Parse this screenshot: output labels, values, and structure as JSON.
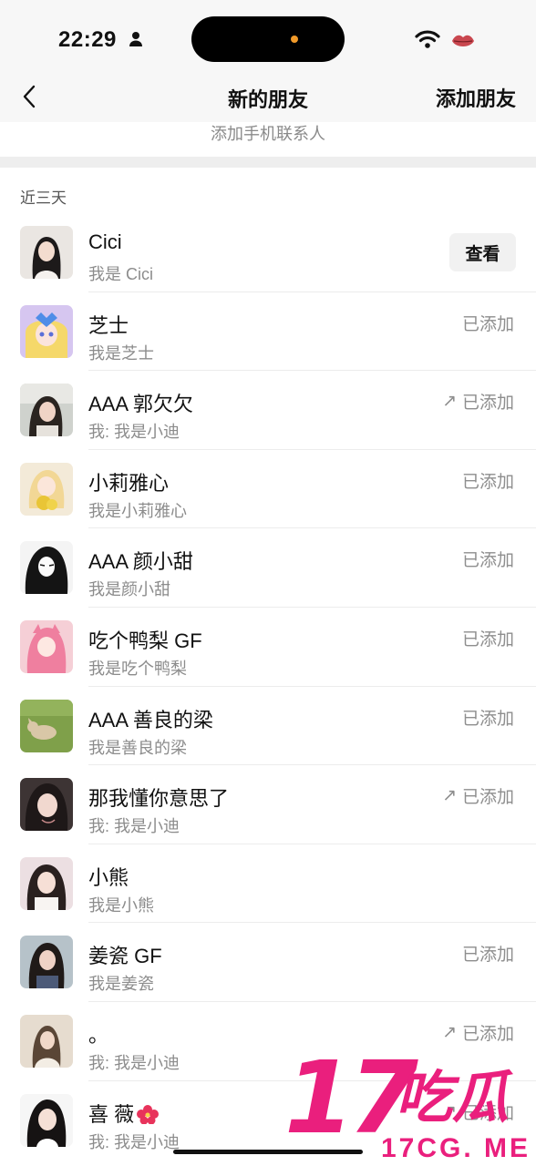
{
  "status_bar": {
    "time": "22:29"
  },
  "nav": {
    "title": "新的朋友",
    "add_friend": "添加朋友"
  },
  "phone_contacts": {
    "label": "添加手机联系人"
  },
  "section": {
    "label": "近三天"
  },
  "colors": {
    "watermark": "#ea1f7d",
    "secondary_text": "#8c8c8c",
    "nav_background": "#f7f7f7"
  },
  "friends": [
    {
      "name": "Cici",
      "message": "我是 Cici",
      "action": "查看"
    },
    {
      "name": "芝士",
      "message": "我是芝士",
      "status": "已添加"
    },
    {
      "name": "AAA 郭欠欠",
      "message": "我: 我是小迪",
      "status": "已添加",
      "arrow": "↗"
    },
    {
      "name": "小莉雅心",
      "message": "我是小莉雅心",
      "status": "已添加"
    },
    {
      "name": "AAA 颜小甜",
      "message": "我是颜小甜",
      "status": "已添加"
    },
    {
      "name": "吃个鸭梨 GF",
      "message": "我是吃个鸭梨",
      "status": "已添加"
    },
    {
      "name": "AAA 善良的梁",
      "message": "我是善良的梁",
      "status": "已添加"
    },
    {
      "name": "那我懂你意思了",
      "message": "我: 我是小迪",
      "status": "已添加",
      "arrow": "↗"
    },
    {
      "name": "小熊",
      "message": "我是小熊"
    },
    {
      "name": "姜瓷 GF",
      "message": "我是姜瓷",
      "status": "已添加"
    },
    {
      "name": "。",
      "message": "我: 我是小迪",
      "status": "已添加",
      "arrow": "↗"
    },
    {
      "name": "喜 薇",
      "message": "我: 我是小迪",
      "status": "已添加",
      "arrow": "↗"
    }
  ],
  "watermark": {
    "number": "17",
    "chinese": "吃瓜",
    "url": "17CG. ME"
  }
}
